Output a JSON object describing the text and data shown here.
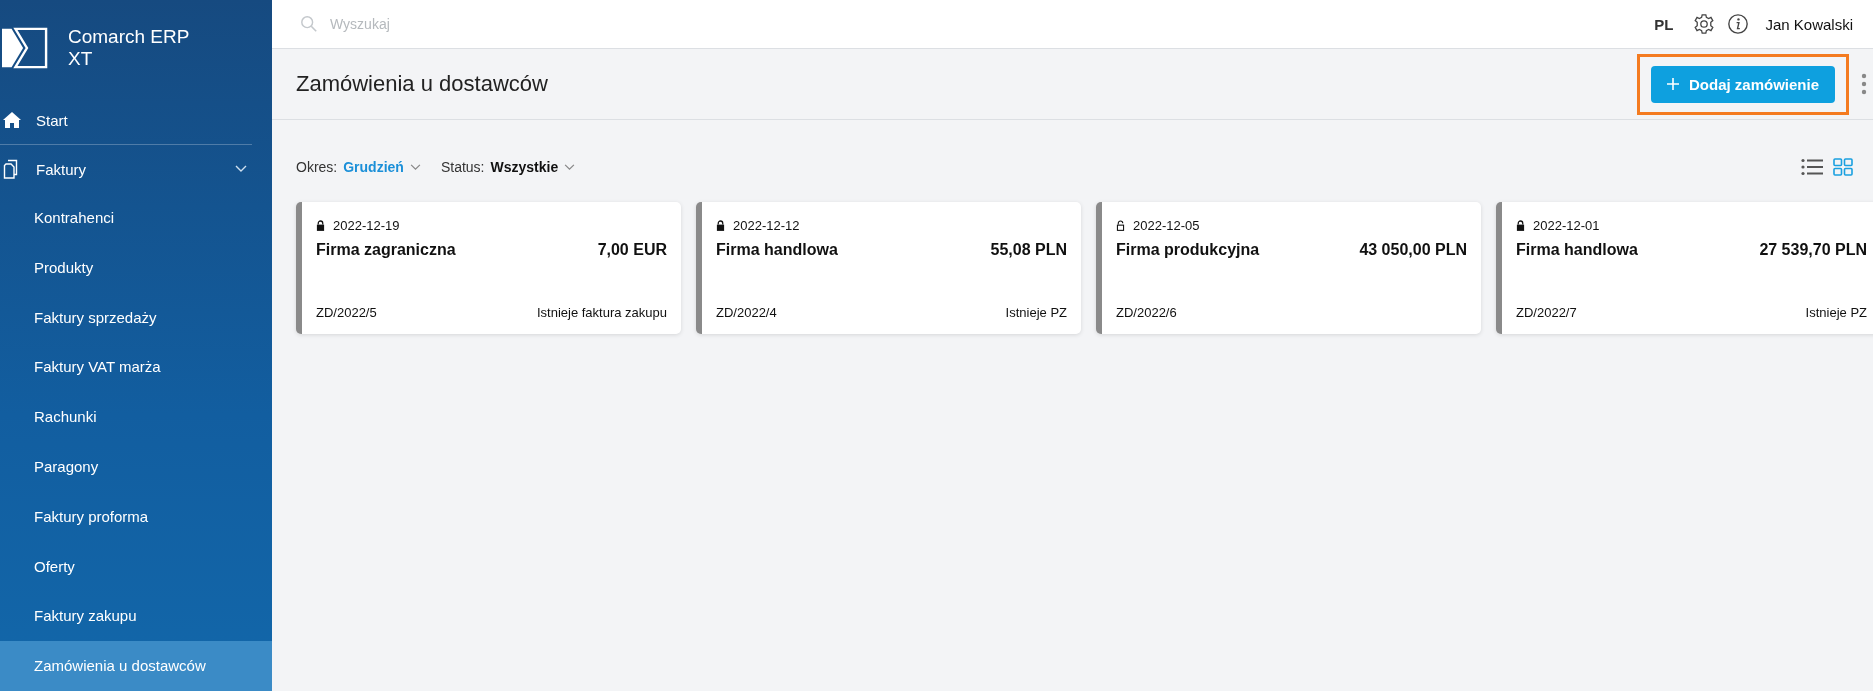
{
  "app": {
    "name": "Comarch ERP XT"
  },
  "sidebar": {
    "items": [
      {
        "label": "Start",
        "kind": "home",
        "selected": false
      },
      {
        "label": "Faktury",
        "kind": "documents",
        "expanded": true,
        "selected": false,
        "children": [
          {
            "label": "Kontrahenci",
            "selected": false
          },
          {
            "label": "Produkty",
            "selected": false
          },
          {
            "label": "Faktury sprzedaży",
            "selected": false
          },
          {
            "label": "Faktury VAT marża",
            "selected": false
          },
          {
            "label": "Rachunki",
            "selected": false
          },
          {
            "label": "Paragony",
            "selected": false
          },
          {
            "label": "Faktury proforma",
            "selected": false
          },
          {
            "label": "Oferty",
            "selected": false
          },
          {
            "label": "Faktury zakupu",
            "selected": false
          },
          {
            "label": "Zamówienia u dostawców",
            "selected": true
          }
        ]
      }
    ]
  },
  "topbar": {
    "search": {
      "placeholder": "Wyszukaj"
    },
    "language": "PL",
    "user": "Jan Kowalski"
  },
  "header": {
    "title": "Zamówienia u dostawców",
    "add_button": {
      "label": "Dodaj zamówienie",
      "highlighted": true
    }
  },
  "filters": [
    {
      "label": "Okres:",
      "value": "Grudzień",
      "kind": "accent"
    },
    {
      "label": "Status:",
      "value": "Wszystkie",
      "kind": "plain"
    }
  ],
  "view_toggle": [
    {
      "kind": "list",
      "selected": false
    },
    {
      "kind": "grid",
      "selected": true
    }
  ],
  "cards": [
    {
      "locked": true,
      "date": "2022-12-19",
      "company": "Firma zagraniczna",
      "amount": "7,00 EUR",
      "number": "ZD/2022/5",
      "status": "Istnieje faktura zakupu"
    },
    {
      "locked": true,
      "date": "2022-12-12",
      "company": "Firma handlowa",
      "amount": "55,08 PLN",
      "number": "ZD/2022/4",
      "status": "Istnieje PZ"
    },
    {
      "locked": false,
      "date": "2022-12-05",
      "company": "Firma produkcyjna",
      "amount": "43 050,00 PLN",
      "number": "ZD/2022/6"
    },
    {
      "locked": true,
      "date": "2022-12-01",
      "company": "Firma handlowa",
      "amount": "27 539,70 PLN",
      "number": "ZD/2022/7",
      "status": "Istnieje PZ"
    }
  ]
}
